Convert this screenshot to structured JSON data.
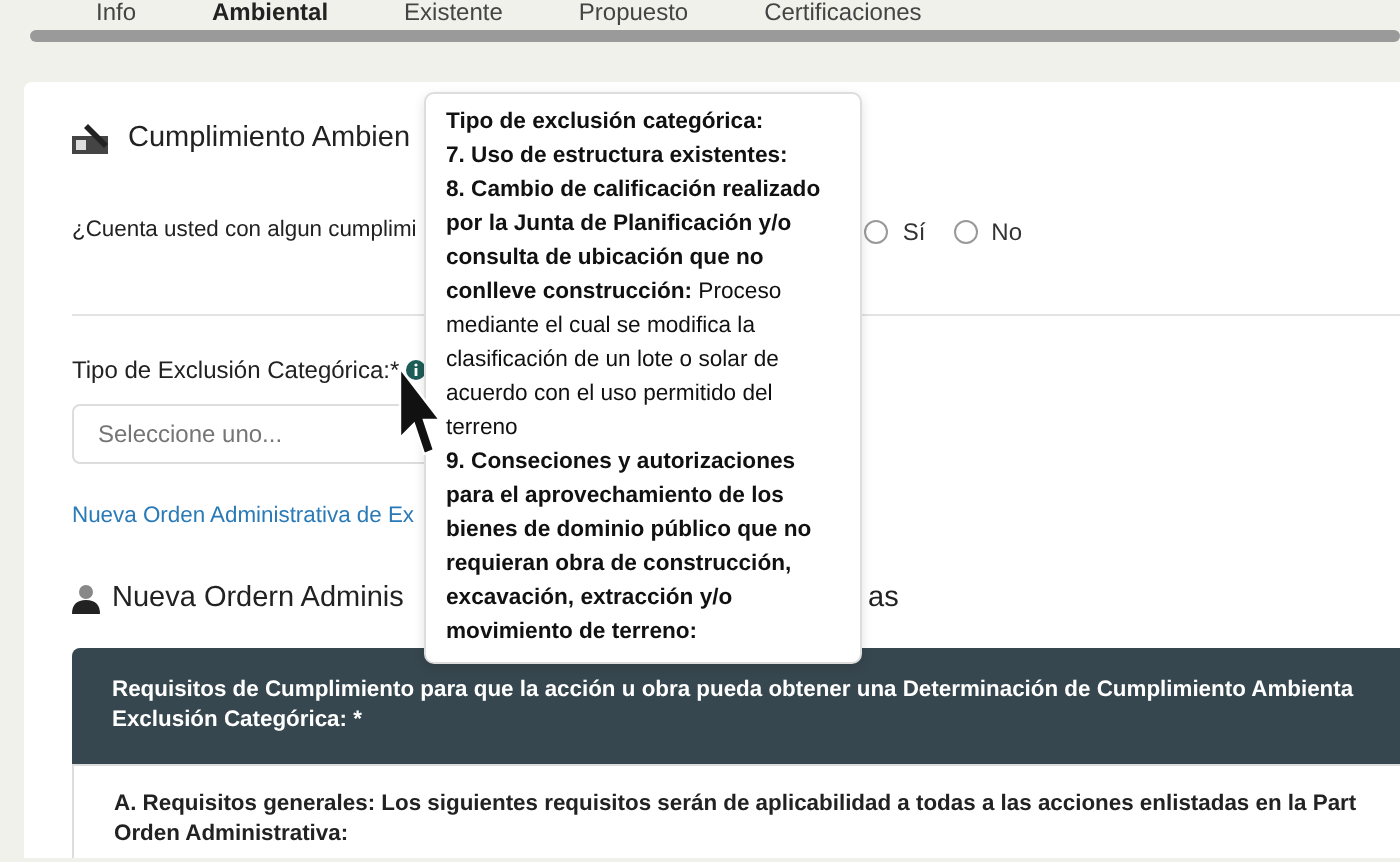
{
  "tabs": [
    {
      "label": "Info",
      "selected": false
    },
    {
      "label": "Ambiental",
      "selected": true
    },
    {
      "label": "Existente",
      "selected": false
    },
    {
      "label": "Propuesto",
      "selected": false
    },
    {
      "label": "Certificaciones",
      "selected": false
    }
  ],
  "section_title": "Cumplimiento Ambien",
  "question": {
    "text": "¿Cuenta usted con algun cumplimi",
    "options": [
      {
        "label": "Sí",
        "selected": false
      },
      {
        "label": "No",
        "selected": false
      }
    ]
  },
  "exclusion_field": {
    "label": "Tipo de Exclusión Categórica:*",
    "placeholder": "Seleccione uno..."
  },
  "link": "Nueva Orden Administrativa de Ex",
  "order_heading": {
    "left": "Nueva Ordern Adminis",
    "right": "as"
  },
  "requirements_panel": {
    "header": [
      "Requisitos de Cumplimiento para que la acción u obra pueda obtener una Determinación de Cumplimiento Ambienta",
      "Exclusión Categórica: *"
    ],
    "body": [
      "A. Requisitos generales: Los siguientes requisitos serán de aplicabilidad a todas a las acciones enlistadas en la Part",
      "Orden Administrativa:"
    ]
  },
  "tooltip": [
    "**Tipo de exclusión categórica:**",
    "**7. Uso de estructura existentes:**",
    "**8. Cambio de calificación realizado por la Junta de Planificación y/o consulta de ubicación que no conlleve construcción:** Proceso mediante el cual se modifica la clasificación de un lote o solar de acuerdo con el uso permitido del terreno",
    "**9. Conseciones y autorizaciones para el aprovechamiento de los bienes de dominio público que no requieran obra de construcción, excavación, extracción y/o movimiento de terreno:**"
  ]
}
